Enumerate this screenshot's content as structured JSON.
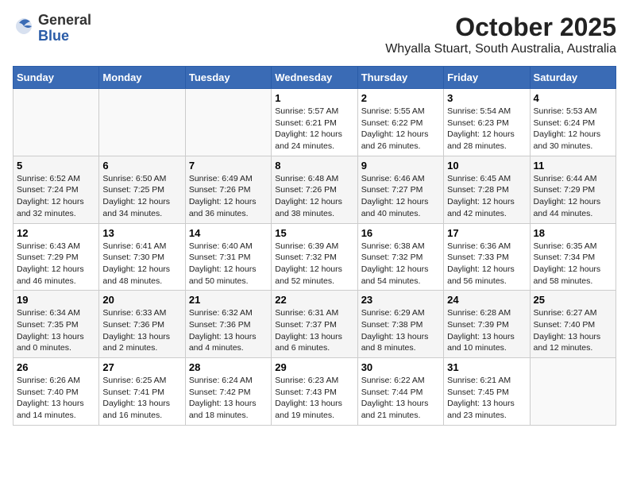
{
  "logo": {
    "general": "General",
    "blue": "Blue"
  },
  "header": {
    "month_year": "October 2025",
    "location": "Whyalla Stuart, South Australia, Australia"
  },
  "days_of_week": [
    "Sunday",
    "Monday",
    "Tuesday",
    "Wednesday",
    "Thursday",
    "Friday",
    "Saturday"
  ],
  "weeks": [
    [
      {
        "day": "",
        "sunrise": "",
        "sunset": "",
        "daylight": ""
      },
      {
        "day": "",
        "sunrise": "",
        "sunset": "",
        "daylight": ""
      },
      {
        "day": "",
        "sunrise": "",
        "sunset": "",
        "daylight": ""
      },
      {
        "day": "1",
        "sunrise": "Sunrise: 5:57 AM",
        "sunset": "Sunset: 6:21 PM",
        "daylight": "Daylight: 12 hours and 24 minutes."
      },
      {
        "day": "2",
        "sunrise": "Sunrise: 5:55 AM",
        "sunset": "Sunset: 6:22 PM",
        "daylight": "Daylight: 12 hours and 26 minutes."
      },
      {
        "day": "3",
        "sunrise": "Sunrise: 5:54 AM",
        "sunset": "Sunset: 6:23 PM",
        "daylight": "Daylight: 12 hours and 28 minutes."
      },
      {
        "day": "4",
        "sunrise": "Sunrise: 5:53 AM",
        "sunset": "Sunset: 6:24 PM",
        "daylight": "Daylight: 12 hours and 30 minutes."
      }
    ],
    [
      {
        "day": "5",
        "sunrise": "Sunrise: 6:52 AM",
        "sunset": "Sunset: 7:24 PM",
        "daylight": "Daylight: 12 hours and 32 minutes."
      },
      {
        "day": "6",
        "sunrise": "Sunrise: 6:50 AM",
        "sunset": "Sunset: 7:25 PM",
        "daylight": "Daylight: 12 hours and 34 minutes."
      },
      {
        "day": "7",
        "sunrise": "Sunrise: 6:49 AM",
        "sunset": "Sunset: 7:26 PM",
        "daylight": "Daylight: 12 hours and 36 minutes."
      },
      {
        "day": "8",
        "sunrise": "Sunrise: 6:48 AM",
        "sunset": "Sunset: 7:26 PM",
        "daylight": "Daylight: 12 hours and 38 minutes."
      },
      {
        "day": "9",
        "sunrise": "Sunrise: 6:46 AM",
        "sunset": "Sunset: 7:27 PM",
        "daylight": "Daylight: 12 hours and 40 minutes."
      },
      {
        "day": "10",
        "sunrise": "Sunrise: 6:45 AM",
        "sunset": "Sunset: 7:28 PM",
        "daylight": "Daylight: 12 hours and 42 minutes."
      },
      {
        "day": "11",
        "sunrise": "Sunrise: 6:44 AM",
        "sunset": "Sunset: 7:29 PM",
        "daylight": "Daylight: 12 hours and 44 minutes."
      }
    ],
    [
      {
        "day": "12",
        "sunrise": "Sunrise: 6:43 AM",
        "sunset": "Sunset: 7:29 PM",
        "daylight": "Daylight: 12 hours and 46 minutes."
      },
      {
        "day": "13",
        "sunrise": "Sunrise: 6:41 AM",
        "sunset": "Sunset: 7:30 PM",
        "daylight": "Daylight: 12 hours and 48 minutes."
      },
      {
        "day": "14",
        "sunrise": "Sunrise: 6:40 AM",
        "sunset": "Sunset: 7:31 PM",
        "daylight": "Daylight: 12 hours and 50 minutes."
      },
      {
        "day": "15",
        "sunrise": "Sunrise: 6:39 AM",
        "sunset": "Sunset: 7:32 PM",
        "daylight": "Daylight: 12 hours and 52 minutes."
      },
      {
        "day": "16",
        "sunrise": "Sunrise: 6:38 AM",
        "sunset": "Sunset: 7:32 PM",
        "daylight": "Daylight: 12 hours and 54 minutes."
      },
      {
        "day": "17",
        "sunrise": "Sunrise: 6:36 AM",
        "sunset": "Sunset: 7:33 PM",
        "daylight": "Daylight: 12 hours and 56 minutes."
      },
      {
        "day": "18",
        "sunrise": "Sunrise: 6:35 AM",
        "sunset": "Sunset: 7:34 PM",
        "daylight": "Daylight: 12 hours and 58 minutes."
      }
    ],
    [
      {
        "day": "19",
        "sunrise": "Sunrise: 6:34 AM",
        "sunset": "Sunset: 7:35 PM",
        "daylight": "Daylight: 13 hours and 0 minutes."
      },
      {
        "day": "20",
        "sunrise": "Sunrise: 6:33 AM",
        "sunset": "Sunset: 7:36 PM",
        "daylight": "Daylight: 13 hours and 2 minutes."
      },
      {
        "day": "21",
        "sunrise": "Sunrise: 6:32 AM",
        "sunset": "Sunset: 7:36 PM",
        "daylight": "Daylight: 13 hours and 4 minutes."
      },
      {
        "day": "22",
        "sunrise": "Sunrise: 6:31 AM",
        "sunset": "Sunset: 7:37 PM",
        "daylight": "Daylight: 13 hours and 6 minutes."
      },
      {
        "day": "23",
        "sunrise": "Sunrise: 6:29 AM",
        "sunset": "Sunset: 7:38 PM",
        "daylight": "Daylight: 13 hours and 8 minutes."
      },
      {
        "day": "24",
        "sunrise": "Sunrise: 6:28 AM",
        "sunset": "Sunset: 7:39 PM",
        "daylight": "Daylight: 13 hours and 10 minutes."
      },
      {
        "day": "25",
        "sunrise": "Sunrise: 6:27 AM",
        "sunset": "Sunset: 7:40 PM",
        "daylight": "Daylight: 13 hours and 12 minutes."
      }
    ],
    [
      {
        "day": "26",
        "sunrise": "Sunrise: 6:26 AM",
        "sunset": "Sunset: 7:40 PM",
        "daylight": "Daylight: 13 hours and 14 minutes."
      },
      {
        "day": "27",
        "sunrise": "Sunrise: 6:25 AM",
        "sunset": "Sunset: 7:41 PM",
        "daylight": "Daylight: 13 hours and 16 minutes."
      },
      {
        "day": "28",
        "sunrise": "Sunrise: 6:24 AM",
        "sunset": "Sunset: 7:42 PM",
        "daylight": "Daylight: 13 hours and 18 minutes."
      },
      {
        "day": "29",
        "sunrise": "Sunrise: 6:23 AM",
        "sunset": "Sunset: 7:43 PM",
        "daylight": "Daylight: 13 hours and 19 minutes."
      },
      {
        "day": "30",
        "sunrise": "Sunrise: 6:22 AM",
        "sunset": "Sunset: 7:44 PM",
        "daylight": "Daylight: 13 hours and 21 minutes."
      },
      {
        "day": "31",
        "sunrise": "Sunrise: 6:21 AM",
        "sunset": "Sunset: 7:45 PM",
        "daylight": "Daylight: 13 hours and 23 minutes."
      },
      {
        "day": "",
        "sunrise": "",
        "sunset": "",
        "daylight": ""
      }
    ]
  ]
}
